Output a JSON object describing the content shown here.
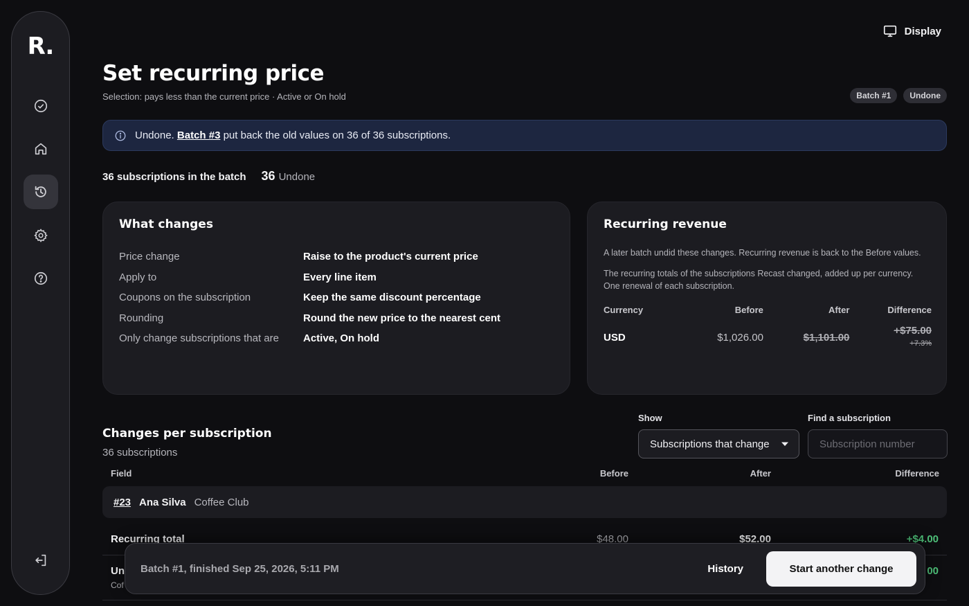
{
  "app": {
    "logo": "R."
  },
  "header": {
    "display_label": "Display",
    "title": "Set recurring price",
    "subtitle": "Selection: pays less than the current price · Active or On hold",
    "badges": [
      "Batch #1",
      "Undone"
    ]
  },
  "banner": {
    "prefix": "Undone.",
    "link": "Batch #3",
    "suffix": "put back the old values on 36 of 36 subscriptions."
  },
  "summary": {
    "count_label": "36 subscriptions in the batch",
    "undone_count": "36",
    "undone_label": "Undone"
  },
  "what_changes": {
    "title": "What changes",
    "rows": [
      {
        "key": "Price change",
        "value": "Raise to the product's current price"
      },
      {
        "key": "Apply to",
        "value": "Every line item"
      },
      {
        "key": "Coupons on the subscription",
        "value": "Keep the same discount percentage"
      },
      {
        "key": "Rounding",
        "value": "Round the new price to the nearest cent"
      },
      {
        "key": "Only change subscriptions that are",
        "value": "Active, On hold"
      }
    ]
  },
  "recurring_revenue": {
    "title": "Recurring revenue",
    "note1": "A later batch undid these changes. Recurring revenue is back to the Before values.",
    "note2": "The recurring totals of the subscriptions Recast changed, added up per currency. One renewal of each subscription.",
    "columns": [
      "Currency",
      "Before",
      "After",
      "Difference"
    ],
    "rows": [
      {
        "currency": "USD",
        "before": "$1,026.00",
        "after": "$1,101.00",
        "difference": "+$75.00",
        "difference_pct": "+7.3%"
      }
    ]
  },
  "changes_section": {
    "title": "Changes per subscription",
    "subtitle": "36 subscriptions",
    "show_label": "Show",
    "show_value": "Subscriptions that change",
    "find_label": "Find a subscription",
    "find_placeholder": "Subscription number",
    "columns": {
      "field": "Field",
      "before": "Before",
      "after": "After",
      "difference": "Difference"
    },
    "group": {
      "id": "#23",
      "name": "Ana Silva",
      "product": "Coffee Club"
    },
    "rows": [
      {
        "field": "Recurring total",
        "before": "$48.00",
        "after": "$52.00",
        "difference": "+$4.00"
      },
      {
        "field": "Un",
        "sub": "Cof",
        "difference": "00"
      }
    ]
  },
  "bottom_bar": {
    "status": "Batch #1, finished Sep 25, 2026, 5:11 PM",
    "history_label": "History",
    "primary_label": "Start another change"
  }
}
